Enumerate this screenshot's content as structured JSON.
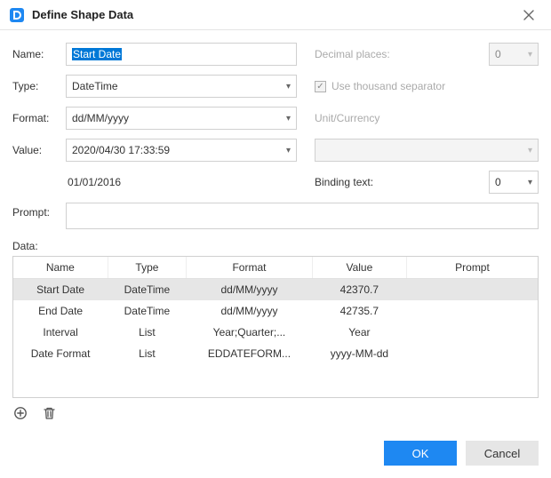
{
  "window": {
    "title": "Define Shape Data"
  },
  "form": {
    "name_label": "Name:",
    "name_value": "Start Date",
    "type_label": "Type:",
    "type_value": "DateTime",
    "format_label": "Format:",
    "format_value": "dd/MM/yyyy",
    "value_label": "Value:",
    "value_value": "2020/04/30 17:33:59",
    "sample_text": "01/01/2016",
    "prompt_label": "Prompt:",
    "prompt_value": "",
    "decimal_label": "Decimal places:",
    "decimal_value": "0",
    "thousand_sep_label": "Use thousand separator",
    "thousand_sep_checked": true,
    "unit_label": "Unit/Currency",
    "unit_value": "",
    "binding_label": "Binding text:",
    "binding_value": "0"
  },
  "data_section": {
    "label": "Data:",
    "columns": [
      "Name",
      "Type",
      "Format",
      "Value",
      "Prompt"
    ],
    "rows": [
      {
        "name": "Start Date",
        "type": "DateTime",
        "format": "dd/MM/yyyy",
        "value": "42370.7",
        "prompt": "",
        "selected": true
      },
      {
        "name": "End Date",
        "type": "DateTime",
        "format": "dd/MM/yyyy",
        "value": "42735.7",
        "prompt": "",
        "selected": false
      },
      {
        "name": "Interval",
        "type": "List",
        "format": "Year;Quarter;...",
        "value": "Year",
        "prompt": "",
        "selected": false
      },
      {
        "name": "Date Format",
        "type": "List",
        "format": "EDDATEFORM...",
        "value": "yyyy-MM-dd",
        "prompt": "",
        "selected": false
      }
    ]
  },
  "buttons": {
    "ok": "OK",
    "cancel": "Cancel"
  }
}
